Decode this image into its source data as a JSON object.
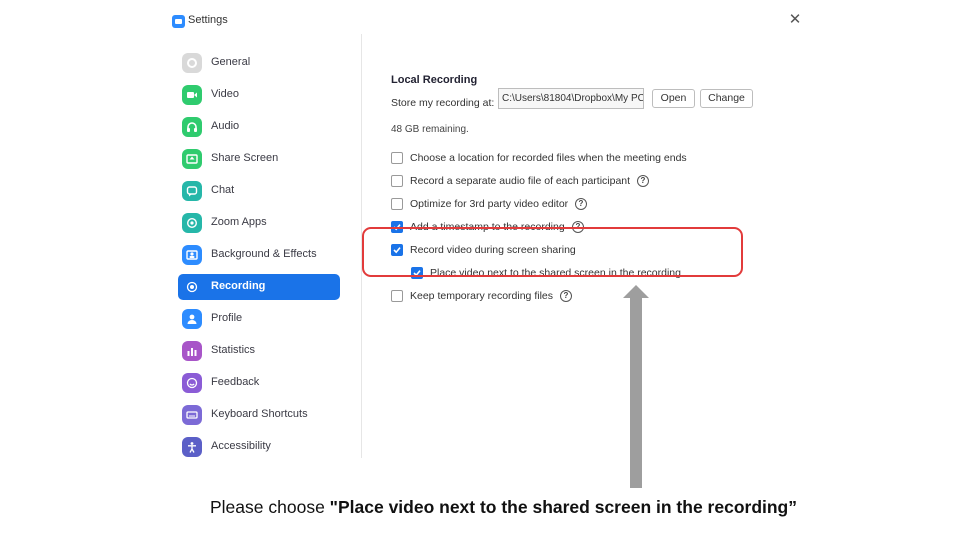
{
  "window": {
    "title": "Settings",
    "close_glyph": "✕"
  },
  "sidebar": {
    "items": [
      {
        "label": "General",
        "icon": "gear-icon",
        "color": "#d9d9d9"
      },
      {
        "label": "Video",
        "icon": "video-icon",
        "color": "#2fcb6e"
      },
      {
        "label": "Audio",
        "icon": "headphone-icon",
        "color": "#2fcb6e"
      },
      {
        "label": "Share Screen",
        "icon": "share-screen-icon",
        "color": "#2fcb6e"
      },
      {
        "label": "Chat",
        "icon": "chat-icon",
        "color": "#26b7a9"
      },
      {
        "label": "Zoom Apps",
        "icon": "apps-icon",
        "color": "#26b7a9"
      },
      {
        "label": "Background & Effects",
        "icon": "background-icon",
        "color": "#2d8cff"
      },
      {
        "label": "Recording",
        "icon": "record-icon",
        "color": "#1a73e8",
        "active": true
      },
      {
        "label": "Profile",
        "icon": "profile-icon",
        "color": "#2d8cff"
      },
      {
        "label": "Statistics",
        "icon": "statistics-icon",
        "color": "#a855c8"
      },
      {
        "label": "Feedback",
        "icon": "feedback-icon",
        "color": "#8b5cd6"
      },
      {
        "label": "Keyboard Shortcuts",
        "icon": "keyboard-icon",
        "color": "#7c6ad6"
      },
      {
        "label": "Accessibility",
        "icon": "accessibility-icon",
        "color": "#5b5fc7"
      }
    ]
  },
  "recording": {
    "section_title": "Local Recording",
    "store_label": "Store my recording at:",
    "path_value": "C:\\Users\\81804\\Dropbox\\My PC",
    "open_label": "Open",
    "change_label": "Change",
    "remaining": "48 GB remaining.",
    "options": [
      {
        "label": "Choose a location for recorded files when the meeting ends",
        "checked": false,
        "help": false
      },
      {
        "label": "Record a separate audio file of each participant",
        "checked": false,
        "help": true
      },
      {
        "label": "Optimize for 3rd party video editor",
        "checked": false,
        "help": true
      },
      {
        "label": "Add a timestamp to the recording",
        "checked": true,
        "help": true
      },
      {
        "label": "Record video during screen sharing",
        "checked": true,
        "help": false
      },
      {
        "label": "Place video next to the shared screen in the recording",
        "checked": true,
        "help": false,
        "sub": true
      },
      {
        "label": "Keep temporary recording files",
        "checked": false,
        "help": true
      }
    ],
    "help_glyph": "?"
  },
  "annotation": {
    "instruction_prefix": "Please choose ",
    "instruction_bold": "\"Place video next to the shared screen in the recording”",
    "highlight_color": "#e23b3b",
    "arrow_color": "#9e9e9e"
  }
}
